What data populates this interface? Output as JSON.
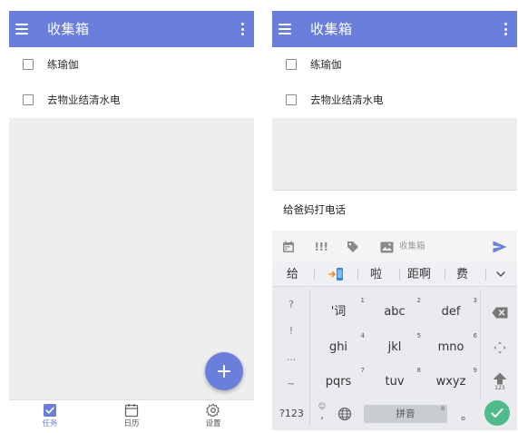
{
  "colors": {
    "accent": "#6a7fdb",
    "enter_key": "#4dbb8a",
    "app_background": "#eeeeee"
  },
  "left": {
    "appbar": {
      "menu_icon": "menu-icon",
      "title": "收集箱",
      "more_icon": "more-vert-icon"
    },
    "tasks": [
      {
        "text": "练瑜伽",
        "checked": false
      },
      {
        "text": "去物业结清水电",
        "checked": false
      }
    ],
    "fab": {
      "icon": "plus-icon",
      "label": "+"
    },
    "bottom_nav": [
      {
        "label": "任务",
        "icon": "check-square-icon",
        "active": true
      },
      {
        "label": "日历",
        "icon": "calendar-icon",
        "active": false
      },
      {
        "label": "设置",
        "icon": "gear-icon",
        "active": false
      }
    ]
  },
  "right": {
    "appbar": {
      "menu_icon": "menu-icon",
      "title": "收集箱",
      "more_icon": "more-vert-icon"
    },
    "tasks": [
      {
        "text": "练瑜伽",
        "checked": false
      },
      {
        "text": "去物业结清水电",
        "checked": false
      }
    ],
    "input": {
      "value": "给爸妈打电话",
      "toolbar": {
        "date_icon": "calendar-icon",
        "priority_label": "!!!",
        "tag_icon": "tag-icon",
        "list_icon": "inbox-icon",
        "list_label": "收集箱",
        "send_icon": "send-icon"
      }
    },
    "keyboard": {
      "candidates": [
        "给",
        "啦",
        "距啊",
        "费"
      ],
      "candidate_app_icon": "phone-app-icon",
      "collapse_icon": "chevron-down-icon",
      "symbols": [
        "?",
        "!",
        "...",
        "~"
      ],
      "keys": [
        {
          "label": "'词",
          "num": "1"
        },
        {
          "label": "abc",
          "num": "2"
        },
        {
          "label": "def",
          "num": "3"
        },
        {
          "label": "ghi",
          "num": "4"
        },
        {
          "label": "jkl",
          "num": "5"
        },
        {
          "label": "mno",
          "num": "6"
        },
        {
          "label": "pqrs",
          "num": "7"
        },
        {
          "label": "tuv",
          "num": "8"
        },
        {
          "label": "wxyz",
          "num": "9"
        }
      ],
      "side_keys": {
        "delete_icon": "backspace-icon",
        "cursor_icon": "move-cursor-icon",
        "shift_icon": "shift-up-icon",
        "shift_label": "123"
      },
      "bottom_row": {
        "sym_label": "?123",
        "emoji_label": "☺",
        "comma_label": ",",
        "globe_icon": "globe-icon",
        "space_label": "拼音",
        "space_num": "0",
        "period_label": "。",
        "enter_icon": "check-icon"
      }
    }
  }
}
